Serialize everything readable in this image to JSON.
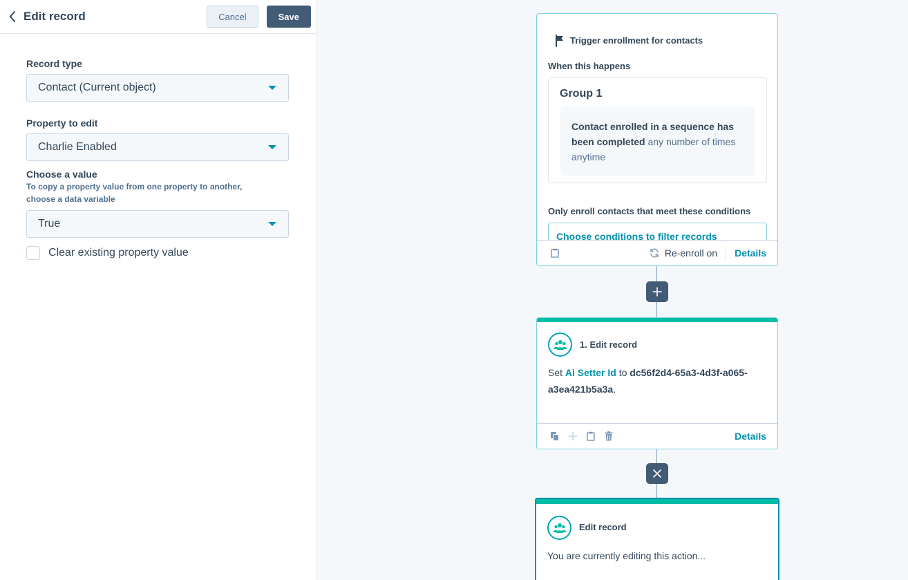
{
  "panel": {
    "title": "Edit record",
    "cancel_label": "Cancel",
    "save_label": "Save",
    "record_type_label": "Record type",
    "record_type_value": "Contact (Current object)",
    "property_label": "Property to edit",
    "property_value": "Charlie Enabled",
    "value_label": "Choose a value",
    "value_hint": "To copy a property value from one property to another, choose a data variable",
    "value_value": "True",
    "clear_label": "Clear existing property value",
    "clear_checked": false
  },
  "trigger": {
    "title": "Trigger enrollment for contacts",
    "when_label": "When this happens",
    "group_title": "Group 1",
    "criteria_bold": "Contact enrolled in a sequence has been completed",
    "criteria_rest": " any number of times anytime",
    "conditions_label": "Only enroll contacts that meet these conditions",
    "filter_link": "Choose conditions to filter records",
    "reenroll_label": "Re-enroll on",
    "details_label": "Details"
  },
  "action1": {
    "title": "1. Edit record",
    "set_word": "Set ",
    "property_link": "Ai Setter Id",
    "to_word": " to ",
    "value": "dc56f2d4-65a3-4d3f-a065-a3ea421b5a3a",
    "period": ".",
    "details_label": "Details"
  },
  "action2": {
    "title": "Edit record",
    "body": "You are currently editing this action..."
  },
  "colors": {
    "accent": "#0091ae",
    "teal": "#00bda5",
    "slate": "#425b76"
  }
}
